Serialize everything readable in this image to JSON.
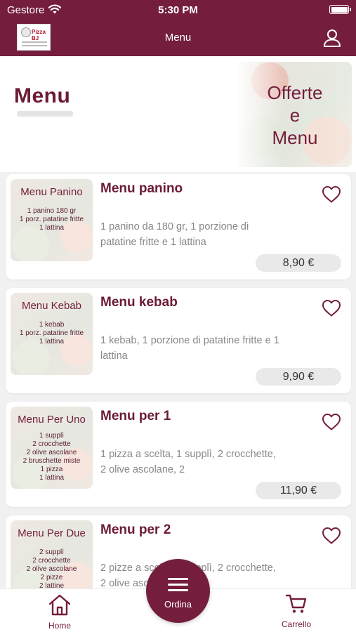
{
  "status_bar": {
    "carrier": "Gestore",
    "time": "5:30 PM",
    "battery_level": 1.0
  },
  "nav": {
    "title": "Menu",
    "logo_text": "Pizza BJ",
    "profile_icon": "user-icon"
  },
  "header": {
    "title": "Menu",
    "promo_text": "Offerte\ne\nMenu"
  },
  "items": [
    {
      "name": "Menu panino",
      "thumb_title": "Menu Panino",
      "thumb_lines": "1 panino 180 gr\n1 porz. patatine fritte\n1 lattina",
      "description": "1 panino da 180 gr, 1 porzione di patatine fritte e 1 lattina",
      "price": "8,90 €"
    },
    {
      "name": "Menu kebab",
      "thumb_title": "Menu Kebab",
      "thumb_lines": "1 kebab\n1 porz. patatine fritte\n1 lattina",
      "description": "1 kebab, 1 porzione di patatine fritte e 1 lattina",
      "price": "9,90 €"
    },
    {
      "name": "Menu per 1",
      "thumb_title": "Menu Per Uno",
      "thumb_lines": "1 supplì\n2 crocchette\n2 olive ascolane\n2 bruschette miste\n1 pizza\n1 lattina",
      "description": "1 pizza a scelta, 1 supplì, 2 crocchette, 2 olive ascolane, 2",
      "price": "11,90 €"
    },
    {
      "name": "Menu per 2",
      "thumb_title": "Menu Per Due",
      "thumb_lines": "2 supplì\n2 crocchette\n2 olive ascolane\n2 pizze\n2 lattine",
      "description": "2 pizze a scelta, 2 supplì, 2 crocchette, 2 olive ascolane e 2",
      "price": ""
    }
  ],
  "tabs": {
    "home": "Home",
    "order": "Ordina",
    "cart": "Carrello"
  },
  "colors": {
    "brand": "#741d3d",
    "background": "#f2f1f1"
  },
  "icons": [
    "wifi-icon",
    "battery-icon",
    "user-icon",
    "heart-icon",
    "home-icon",
    "menu-icon",
    "cart-icon"
  ]
}
